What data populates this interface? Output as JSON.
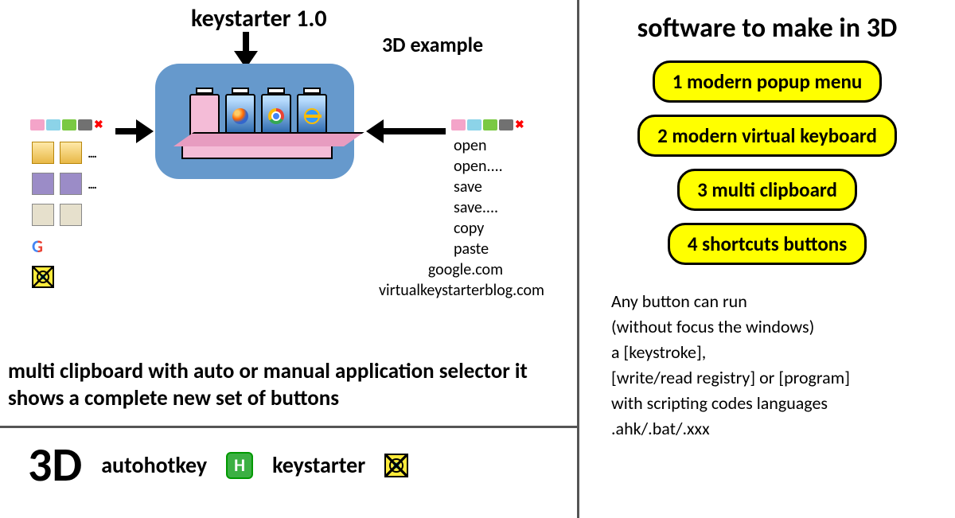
{
  "left": {
    "title": "keystarter 1.0",
    "example_label": "3D example",
    "actions": [
      "open",
      "open....",
      "save",
      "save....",
      "copy",
      "paste"
    ],
    "actions_center": [
      "google.com",
      "virtualkeystarterblog.com"
    ],
    "description": "multi clipboard with auto or manual application selector it shows a complete new set of buttons",
    "footer": {
      "big": "3D",
      "ahk": "autohotkey",
      "ks": "keystarter"
    }
  },
  "right": {
    "title": "software to make in 3D",
    "pills": [
      "1 modern popup menu",
      "2 modern virtual keyboard",
      "3 multi clipboard",
      "4 shortcuts buttons"
    ],
    "desc_lines": [
      "Any button can run",
      "  (without focus the windows)",
      "          a [keystroke],",
      "[write/read registry] or [program]",
      "with scripting codes languages",
      ".ahk/.bat/.xxx"
    ]
  }
}
